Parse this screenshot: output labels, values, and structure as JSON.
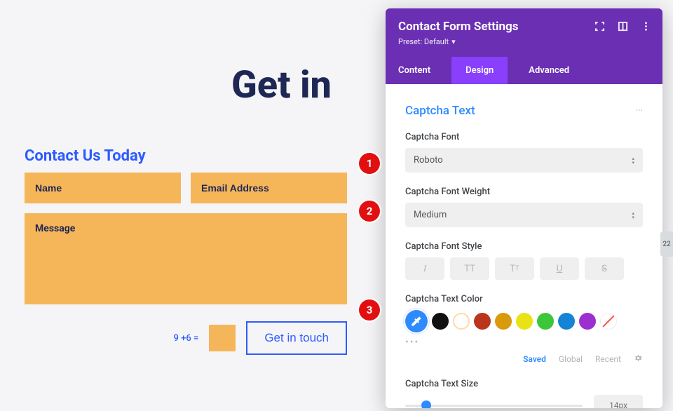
{
  "hero": {
    "title": "Get in"
  },
  "contact": {
    "heading": "Contact Us Today",
    "name_placeholder": "Name",
    "email_placeholder": "Email Address",
    "message_placeholder": "Message",
    "captcha_equation": "9 +6 =",
    "submit_label": "Get in touch"
  },
  "settings_panel": {
    "title": "Contact Form Settings",
    "preset_label": "Preset: Default",
    "tabs": {
      "content": "Content",
      "design": "Design",
      "advanced": "Advanced"
    },
    "section_title": "Captcha Text",
    "font": {
      "label": "Captcha Font",
      "value": "Roboto"
    },
    "weight": {
      "label": "Captcha Font Weight",
      "value": "Medium"
    },
    "style": {
      "label": "Captcha Font Style"
    },
    "color": {
      "label": "Captcha Text Color",
      "active": "#2e8bff",
      "swatches": [
        "#111111",
        "outline",
        "#b9361c",
        "#d99a0b",
        "#e9e316",
        "#3cc63c",
        "#1584d6",
        "#9b2fd0",
        "none"
      ],
      "tabs": {
        "saved": "Saved",
        "global": "Global",
        "recent": "Recent"
      }
    },
    "size": {
      "label": "Captcha Text Size",
      "value": "14px"
    }
  },
  "annotation_badges": [
    "1",
    "2",
    "3"
  ],
  "edge_tab": "22"
}
